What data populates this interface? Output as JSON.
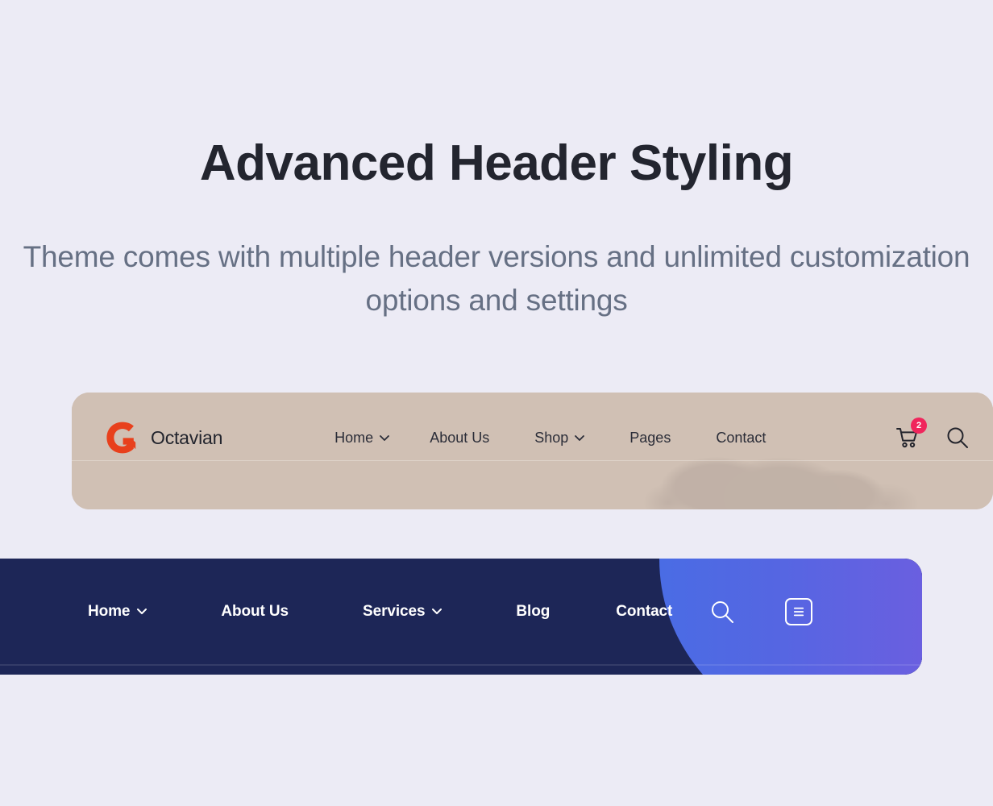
{
  "page": {
    "background_color": "#ecebf5"
  },
  "hero": {
    "title": "Advanced Header Styling",
    "subtitle": "Theme comes with multiple header versions and unlimited customization options and settings",
    "title_color": "#23252f",
    "subtitle_color": "#667084"
  },
  "header_light": {
    "background_color": "#d0c1b5",
    "brand": {
      "name": "Octavian",
      "logo_name": "octavian-logo",
      "logo_color": "#e8401c"
    },
    "nav": [
      {
        "label": "Home",
        "has_dropdown": true
      },
      {
        "label": "About Us",
        "has_dropdown": false
      },
      {
        "label": "Shop",
        "has_dropdown": true
      },
      {
        "label": "Pages",
        "has_dropdown": false
      },
      {
        "label": "Contact",
        "has_dropdown": false
      }
    ],
    "cart": {
      "icon": "shopping-cart-icon",
      "badge_count": "2",
      "badge_color": "#f0265c"
    },
    "search": {
      "icon": "search-icon"
    }
  },
  "header_dark": {
    "background_color": "#1d2657",
    "accent_gradient_from": "#4c6ae2",
    "accent_gradient_to": "#6a5fe0",
    "nav": [
      {
        "label": "Home",
        "has_dropdown": true
      },
      {
        "label": "About Us",
        "has_dropdown": false
      },
      {
        "label": "Services",
        "has_dropdown": true
      },
      {
        "label": "Blog",
        "has_dropdown": false
      },
      {
        "label": "Contact",
        "has_dropdown": false
      }
    ],
    "search": {
      "icon": "search-icon"
    },
    "menu": {
      "icon": "hamburger-menu-icon"
    }
  }
}
